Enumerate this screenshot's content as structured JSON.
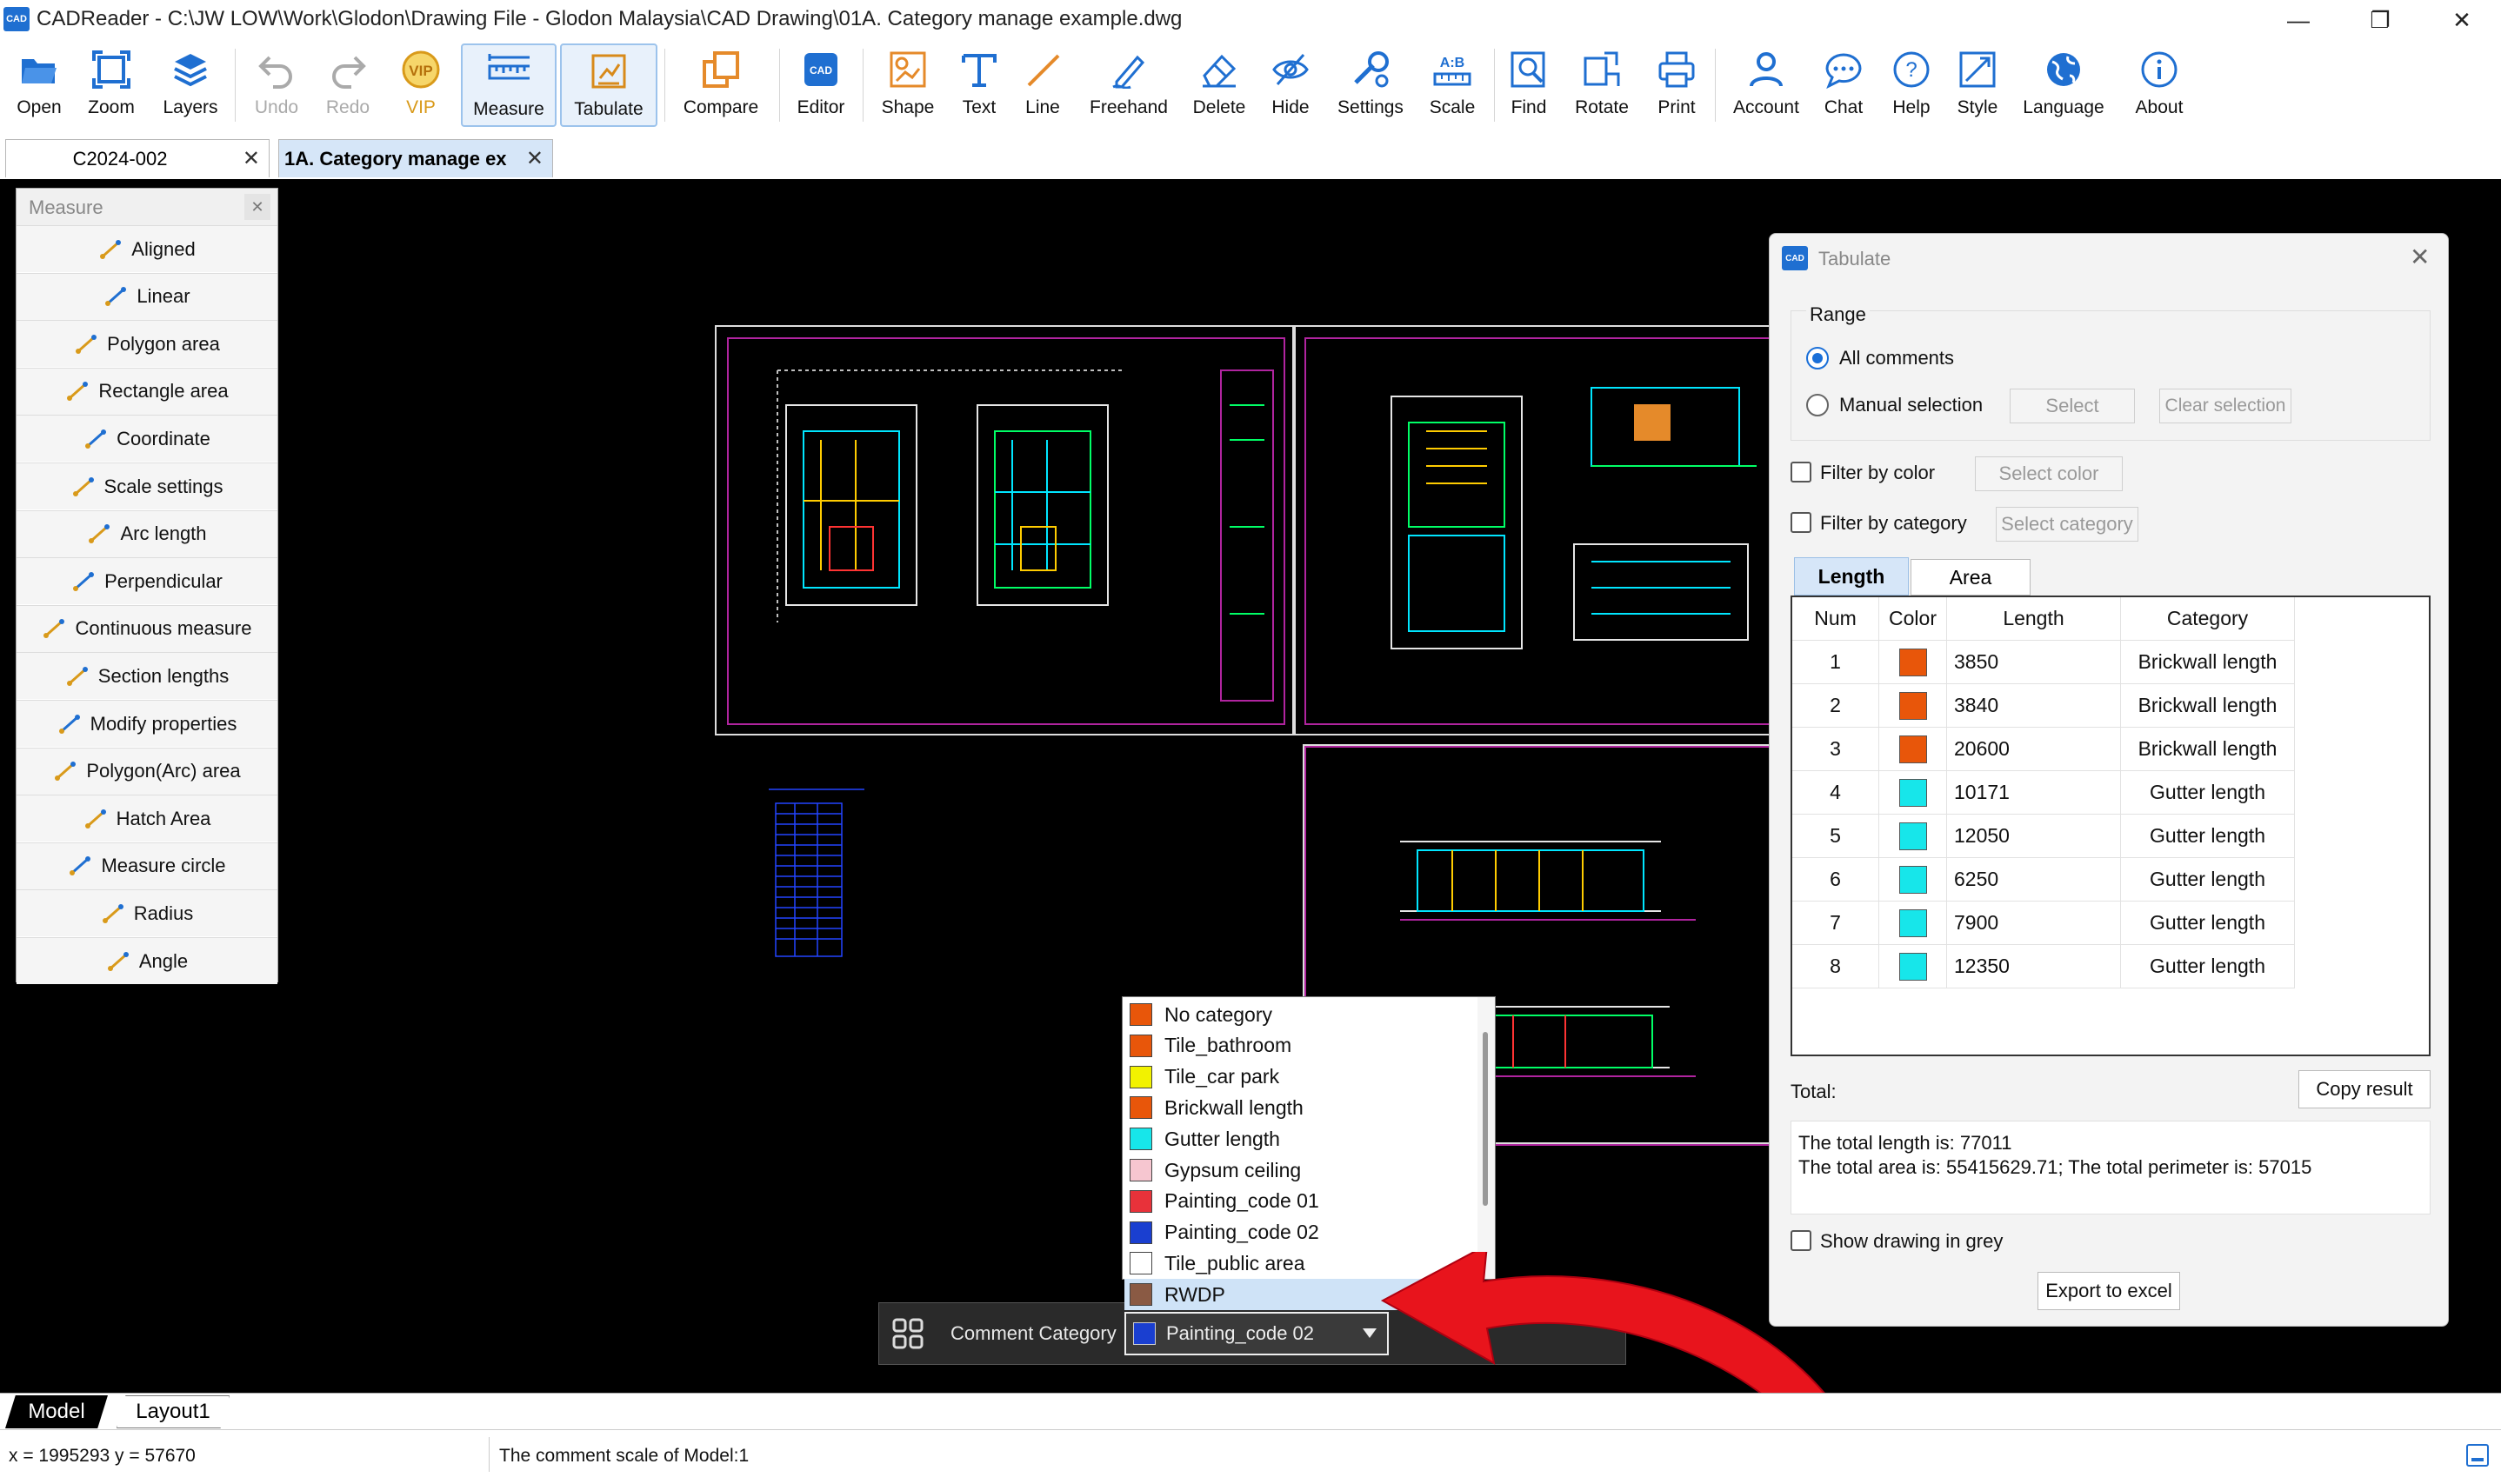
{
  "window": {
    "app_logo": "CAD",
    "title": "CADReader - C:\\JW LOW\\Work\\Glodon\\Drawing File - Glodon Malaysia\\CAD Drawing\\01A. Category manage example.dwg"
  },
  "toolbar": {
    "items": [
      {
        "label": "Open",
        "icon": "folder-open-icon"
      },
      {
        "label": "Zoom",
        "icon": "zoom-icon"
      },
      {
        "label": "Layers",
        "icon": "layers-icon"
      },
      {
        "label": "Undo",
        "icon": "undo-icon"
      },
      {
        "label": "Redo",
        "icon": "redo-icon"
      },
      {
        "label": "VIP",
        "icon": "vip-icon"
      },
      {
        "label": "Measure",
        "icon": "ruler-icon"
      },
      {
        "label": "Tabulate",
        "icon": "tabulate-icon"
      },
      {
        "label": "Compare",
        "icon": "compare-icon"
      },
      {
        "label": "Editor",
        "icon": "cad-editor-icon"
      },
      {
        "label": "Shape",
        "icon": "shape-icon"
      },
      {
        "label": "Text",
        "icon": "text-icon"
      },
      {
        "label": "Line",
        "icon": "line-icon"
      },
      {
        "label": "Freehand",
        "icon": "pen-icon"
      },
      {
        "label": "Delete",
        "icon": "eraser-icon"
      },
      {
        "label": "Hide",
        "icon": "eye-off-icon"
      },
      {
        "label": "Settings",
        "icon": "settings-icon"
      },
      {
        "label": "Scale",
        "icon": "scale-icon"
      },
      {
        "label": "Find",
        "icon": "find-icon"
      },
      {
        "label": "Rotate",
        "icon": "rotate-icon"
      },
      {
        "label": "Print",
        "icon": "printer-icon"
      },
      {
        "label": "Account",
        "icon": "user-icon"
      },
      {
        "label": "Chat",
        "icon": "chat-icon"
      },
      {
        "label": "Help",
        "icon": "help-icon"
      },
      {
        "label": "Style",
        "icon": "style-icon"
      },
      {
        "label": "Language",
        "icon": "globe-icon"
      },
      {
        "label": "About",
        "icon": "info-icon"
      }
    ]
  },
  "tabs": [
    {
      "label": "C2024-002"
    },
    {
      "label": "1A. Category manage ex"
    }
  ],
  "measure_panel": {
    "title": "Measure",
    "items": [
      "Aligned",
      "Linear",
      "Polygon area",
      "Rectangle area",
      "Coordinate",
      "Scale settings",
      "Arc length",
      "Perpendicular",
      "Continuous measure",
      "Section lengths",
      "Modify properties",
      "Polygon(Arc) area",
      "Hatch Area",
      "Measure circle",
      "Radius",
      "Angle"
    ]
  },
  "tabulate": {
    "title": "Tabulate",
    "logo": "CAD",
    "range_label": "Range",
    "all_comments": "All comments",
    "manual_selection": "Manual selection",
    "select_btn": "Select",
    "clear_btn": "Clear selection",
    "filter_color": "Filter by color",
    "select_color": "Select color",
    "filter_category": "Filter by category",
    "select_category": "Select category",
    "tab_length": "Length",
    "tab_area": "Area",
    "columns": [
      "Num",
      "Color",
      "Length",
      "Category"
    ],
    "rows": [
      {
        "num": "1",
        "color": "#e8560a",
        "length": "3850",
        "category": "Brickwall length"
      },
      {
        "num": "2",
        "color": "#e8560a",
        "length": "3840",
        "category": "Brickwall length"
      },
      {
        "num": "3",
        "color": "#e8560a",
        "length": "20600",
        "category": "Brickwall length"
      },
      {
        "num": "4",
        "color": "#17e6ea",
        "length": "10171",
        "category": "Gutter length"
      },
      {
        "num": "5",
        "color": "#17e6ea",
        "length": "12050",
        "category": "Gutter length"
      },
      {
        "num": "6",
        "color": "#17e6ea",
        "length": "6250",
        "category": "Gutter length"
      },
      {
        "num": "7",
        "color": "#17e6ea",
        "length": "7900",
        "category": "Gutter length"
      },
      {
        "num": "8",
        "color": "#17e6ea",
        "length": "12350",
        "category": "Gutter length"
      }
    ],
    "total_label": "Total:",
    "copy_result": "Copy result",
    "total_length": "The total length is: 77011",
    "total_area": "The total area is: 55415629.71; The total perimeter is: 57015",
    "show_grey": "Show drawing in grey",
    "export_excel": "Export to excel"
  },
  "category_dropdown": {
    "items": [
      {
        "label": "No category",
        "color": "#e8560a"
      },
      {
        "label": "Tile_bathroom",
        "color": "#e8560a"
      },
      {
        "label": "Tile_car park",
        "color": "#f2f200"
      },
      {
        "label": "Brickwall length",
        "color": "#e8560a"
      },
      {
        "label": "Gutter length",
        "color": "#17e6ea"
      },
      {
        "label": "Gypsum ceiling",
        "color": "#f6c6d0"
      },
      {
        "label": "Painting_code 01",
        "color": "#e8323a"
      },
      {
        "label": "Painting_code 02",
        "color": "#1a3fd0"
      },
      {
        "label": "Tile_public area",
        "color": "#ffffff"
      },
      {
        "label": "RWDP",
        "color": "#8a5a44"
      }
    ],
    "selected_index": 9
  },
  "comment_category": {
    "label": "Comment Category",
    "selected": "Painting_code 02",
    "selected_color": "#1a3fd0"
  },
  "layout_tabs": [
    "Model",
    "Layout1"
  ],
  "status": {
    "coords": "x = 1995293 y = 57670",
    "scale_text": "The comment scale of Model:1"
  }
}
